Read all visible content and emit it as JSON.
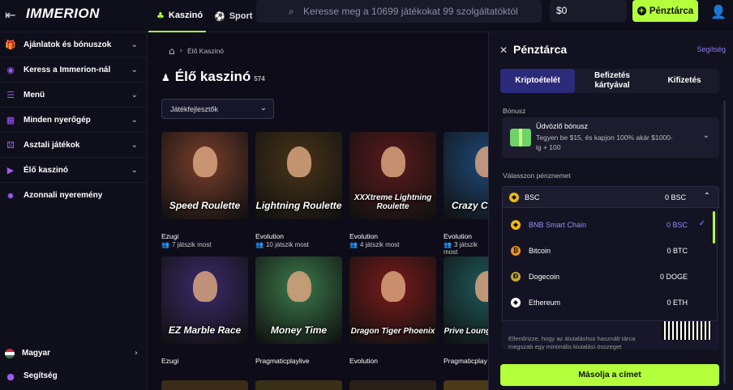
{
  "header": {
    "logo": "IMMERION",
    "tabs": [
      {
        "label": "Kaszinó"
      },
      {
        "label": "Sport"
      }
    ],
    "search_placeholder": "Keresse meg a 10699 játékokat 99 szolgáltatóktól",
    "balance": "$0",
    "wallet_button": "Pénztárca"
  },
  "sidebar": {
    "items": [
      {
        "label": "Ajánlatok és bónuszok"
      },
      {
        "label": "Keress a Immerion-nál"
      },
      {
        "label": "Menü"
      },
      {
        "label": "Minden nyerőgép"
      },
      {
        "label": "Asztali játékok"
      },
      {
        "label": "Élő kaszinó"
      },
      {
        "label": "Azonnali nyeremény"
      }
    ],
    "language": "Magyar",
    "help": "Segítség"
  },
  "main": {
    "breadcrumb": "Élő Kaszinó",
    "title": "Élő kaszinó",
    "count": "574",
    "filter": "Játékfejlesztők",
    "games_row1": [
      {
        "name": "Speed Roulette",
        "provider": "Ezugi",
        "players": "7 játszik most",
        "color": "#7a3e2c"
      },
      {
        "name": "Lightning Roulette",
        "provider": "Evolution",
        "players": "10 játszik most",
        "color": "#4a3418"
      },
      {
        "name": "XXXtreme Lightning Roulette",
        "provider": "Evolution",
        "players": "4 játszik most",
        "color": "#5a1a1c"
      },
      {
        "name": "Crazy Coin Flip",
        "provider": "Evolution",
        "players": "3 játszik most",
        "color": "#1e4a7a"
      }
    ],
    "games_row2": [
      {
        "name": "EZ Marble Race",
        "provider": "Ezugi",
        "color": "#3b2a6a"
      },
      {
        "name": "Money Time",
        "provider": "Pragmaticplaylive",
        "color": "#3b7a4a"
      },
      {
        "name": "Dragon Tiger Phoenix",
        "provider": "Evolution",
        "color": "#7a1a1a"
      },
      {
        "name": "Prive Lounge Roulette",
        "provider": "Pragmaticplay",
        "color": "#1e5a5a"
      }
    ]
  },
  "wallet": {
    "title": "Pénztárca",
    "help": "Segítség",
    "tabs": [
      {
        "label": "Kriptoételét"
      },
      {
        "label": "Befizetés kártyával"
      },
      {
        "label": "Kifizetés"
      }
    ],
    "bonus_label": "Bónusz",
    "bonus_title": "Üdvözlő bónusz",
    "bonus_desc": "Tegyen be $15, és kapjon 100% akár $1000-ig + 100",
    "currency_label": "Válasszon pénznemet",
    "selected_currency": {
      "name": "BSC",
      "value": "0 BSC"
    },
    "currencies": [
      {
        "name": "BNB Smart Chain",
        "value": "0 BSC",
        "color": "#f0b90b",
        "glyph": "◆"
      },
      {
        "name": "Bitcoin",
        "value": "0 BTC",
        "color": "#f7931a",
        "glyph": "₿"
      },
      {
        "name": "Dogecoin",
        "value": "0 DOGE",
        "color": "#c2a633",
        "glyph": "Ð"
      },
      {
        "name": "Ethereum",
        "value": "0 ETH",
        "color": "#ffffff",
        "glyph": "◆"
      }
    ],
    "warning": "Ellenőrizze, hogy az átutaláshoz használt tárca megszab egy minimális kiutalási összeget",
    "copy_button": "Másolja a címet"
  }
}
